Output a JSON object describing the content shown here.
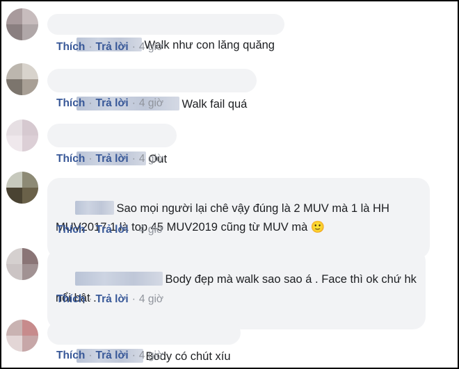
{
  "comments": [
    {
      "text": "Walk như con lăng quăng",
      "like_label": "Thích",
      "reply_label": "Trả lời",
      "time": "4 giờ",
      "avatar_colors": [
        "#a89a9c",
        "#c7bcbd",
        "#8a7f80",
        "#b0a7a8"
      ]
    },
    {
      "text": "Walk fail quá",
      "like_label": "Thích",
      "reply_label": "Trả lời",
      "time": "4 giờ",
      "avatar_colors": [
        "#bcb6ae",
        "#d8d3cc",
        "#7c756d",
        "#a89f95"
      ]
    },
    {
      "text": "Out",
      "like_label": "Thích",
      "reply_label": "Trả lời",
      "time": "4 giờ",
      "avatar_colors": [
        "#e6dfe3",
        "#d6c9d0",
        "#efe8ec",
        "#dccfd6"
      ]
    },
    {
      "text": "Sao mọi người lại chê vậy đúng là 2 MUV mà 1 là HH MUV2017 1 là top 45 MUV2019 cũng từ MUV mà 🙂",
      "like_label": "Thích",
      "reply_label": "Trả lời",
      "time": "4 giờ",
      "avatar_colors": [
        "#c7c9bd",
        "#8d8a75",
        "#4a4332",
        "#6a6149"
      ]
    },
    {
      "text": "Body đẹp mà walk sao sao á . Face thì ok chứ hk nổi bật .",
      "like_label": "Thích",
      "reply_label": "Trả lời",
      "time": "4 giờ",
      "avatar_colors": [
        "#d5d0cf",
        "#8a7576",
        "#cbc4c4",
        "#a19293"
      ]
    },
    {
      "text": "Body có chút xíu",
      "like_label": "Thích",
      "reply_label": "Trả lời",
      "time": "4 giờ",
      "avatar_colors": [
        "#c9b3b2",
        "#c78b8c",
        "#e3d6d6",
        "#c7a7a8"
      ]
    }
  ]
}
